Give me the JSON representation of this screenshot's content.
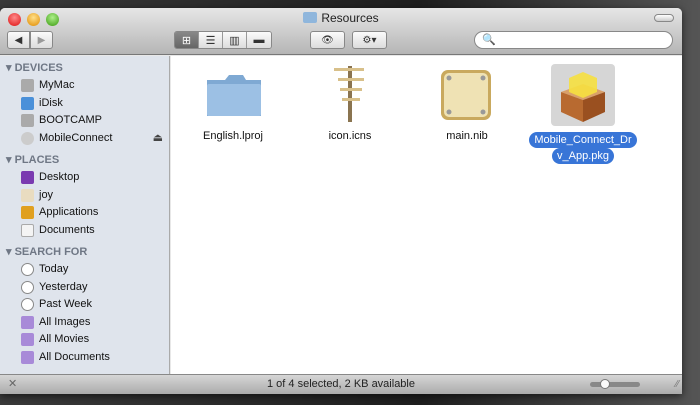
{
  "window": {
    "title": "Resources"
  },
  "toolbar": {
    "back": "◀",
    "forward": "▶",
    "views": [
      "icon-view",
      "list-view",
      "column-view",
      "coverflow-view"
    ],
    "quicklook": "👁",
    "action": "⚙▾",
    "search_placeholder": ""
  },
  "sidebar": {
    "sections": [
      {
        "label": "DEVICES",
        "items": [
          "MyMac",
          "iDisk",
          "BOOTCAMP",
          "MobileConnect"
        ]
      },
      {
        "label": "PLACES",
        "items": [
          "Desktop",
          "joy",
          "Applications",
          "Documents"
        ]
      },
      {
        "label": "SEARCH FOR",
        "items": [
          "Today",
          "Yesterday",
          "Past Week",
          "All Images",
          "All Movies",
          "All Documents"
        ]
      }
    ],
    "eject": "⏏"
  },
  "files": [
    {
      "name": "English.lproj",
      "kind": "folder"
    },
    {
      "name": "icon.icns",
      "kind": "icns"
    },
    {
      "name": "main.nib",
      "kind": "nib"
    },
    {
      "name": "Mobile_Connect_Drv_App.pkg",
      "line1": "Mobile_Connect_Dr",
      "line2": "v_App.pkg",
      "kind": "pkg",
      "selected": true
    }
  ],
  "status": {
    "text": "1 of 4 selected, 2 KB available",
    "zoom_fraction": 0.25
  }
}
